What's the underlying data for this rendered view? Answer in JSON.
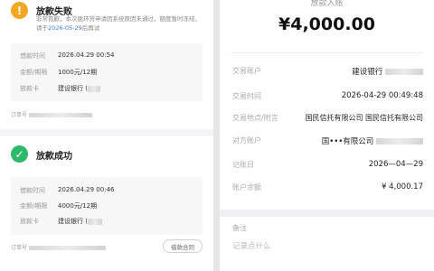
{
  "fail": {
    "title": "放款失败",
    "notice_text": "非常抱歉，本次循环贷申请因系统原因未通过，额度暂时冻结，请于",
    "notice_date": "2026-05-29",
    "notice_suffix": "后再试",
    "time_label": "借款时间",
    "time_value": "2026.04.29 00:54",
    "amount_label": "金额/期限",
    "amount_value": "1000元/12期",
    "card_label": "放款卡",
    "card_value": "建设银行 (",
    "order_label": "订单号"
  },
  "success": {
    "title": "放款成功",
    "time_label": "借款时间",
    "time_value": "2026.04.29 00:46",
    "amount_label": "金额/期限",
    "amount_value": "4000元/12期",
    "card_label": "放款卡",
    "card_value": "建设银行 (",
    "order_label": "订单号",
    "contract_button": "借款合同"
  },
  "detail": {
    "amount_label": "放款入账",
    "amount": "¥4,000.00",
    "rows": [
      {
        "label": "交易账户",
        "value": "建设银行"
      },
      {
        "label": "交易时间",
        "value": "2026-04-29 00:49:48"
      },
      {
        "label": "交易地点/附言",
        "value": "国民信托有限公司 国民信托有限公司"
      },
      {
        "label": "对方账户",
        "value": "国•••有限公司"
      },
      {
        "label": "记账日",
        "value": "2026—04—29"
      },
      {
        "label": "账户余额",
        "value": "¥ 4,000.17"
      }
    ],
    "note_label": "备注",
    "note_placeholder": "记录点什么"
  },
  "colors": {
    "fail_icon": "#f5a623",
    "success_icon": "#2db96a",
    "link_date": "#3a7bd5"
  },
  "icons": {
    "fail": "exclamation-icon",
    "success": "check-icon"
  }
}
